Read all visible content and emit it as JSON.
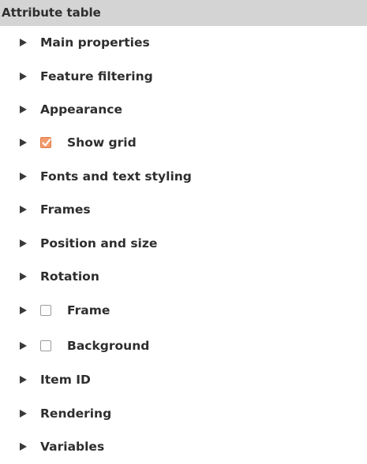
{
  "panel": {
    "title": "Attribute table"
  },
  "groups": [
    {
      "label": "Main properties",
      "has_checkbox": false
    },
    {
      "label": "Feature filtering",
      "has_checkbox": false
    },
    {
      "label": "Appearance",
      "has_checkbox": false
    },
    {
      "label": "Show grid",
      "has_checkbox": true,
      "checked": true
    },
    {
      "label": "Fonts and text styling",
      "has_checkbox": false
    },
    {
      "label": "Frames",
      "has_checkbox": false
    },
    {
      "label": "Position and size",
      "has_checkbox": false
    },
    {
      "label": "Rotation",
      "has_checkbox": false
    },
    {
      "label": "Frame",
      "has_checkbox": true,
      "checked": false
    },
    {
      "label": "Background",
      "has_checkbox": true,
      "checked": false
    },
    {
      "label": "Item ID",
      "has_checkbox": false
    },
    {
      "label": "Rendering",
      "has_checkbox": false
    },
    {
      "label": "Variables",
      "has_checkbox": false
    }
  ],
  "icons": {
    "collapsed": "triangle-right-icon",
    "check": "checkmark-icon"
  },
  "colors": {
    "header_bg": "#d4d4d4",
    "checkbox_checked": "#f39b6b"
  }
}
